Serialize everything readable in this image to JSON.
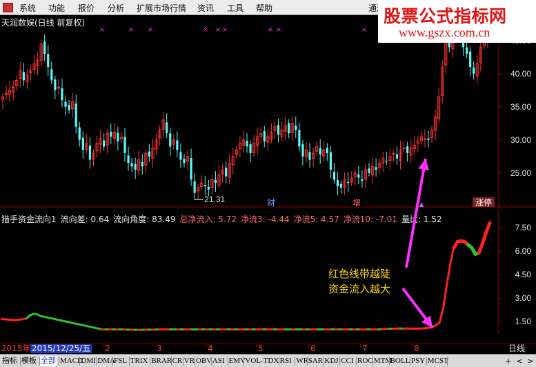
{
  "menu": {
    "items": [
      "系统",
      "功能",
      "报价",
      "分析",
      "扩展市场行情",
      "资讯",
      "工具",
      "帮助"
    ],
    "right_partial": "通达"
  },
  "watermark": {
    "title": "股票公式指标网",
    "url": "www.gszx.com.cn"
  },
  "stock_title": "天润数娱(日线 前复权)",
  "indicator_line": [
    {
      "text": "猎手资金流向1",
      "color": "white"
    },
    {
      "text": "流向差: 0.64",
      "color": "white"
    },
    {
      "text": "流向角度: 83.49",
      "color": "white"
    },
    {
      "text": "总净流入: 5.72",
      "color": "red"
    },
    {
      "text": "净流3: -4.44",
      "color": "red"
    },
    {
      "text": "净流5: 4.57",
      "color": "red"
    },
    {
      "text": "净流10: -7.01",
      "color": "red"
    },
    {
      "text": "量比: 1.52",
      "color": "white"
    }
  ],
  "annotation": {
    "line1": "红色线带越陡",
    "line2": "资金流入越大"
  },
  "event_labels": [
    "财",
    "增",
    "涨停"
  ],
  "chart_data": [
    {
      "type": "candlestick",
      "title": "天润数娱(日线 前复权)",
      "y_ticks": [
        25.0,
        30.0,
        35.0,
        40.0,
        45.0
      ],
      "ylim": [
        20.5,
        48
      ],
      "low_annotation": "21.31",
      "x_month_labels": [
        "2",
        "3",
        "4",
        "5",
        "6",
        "7",
        "8"
      ],
      "bullish_color": "#ff3030",
      "bearish_color": "#54fcfc",
      "close": [
        36.5,
        37.0,
        37.5,
        38.0,
        39.0,
        40.5,
        39.0,
        39.8,
        40.5,
        41.5,
        42.0,
        44.5,
        43.0,
        41.0,
        39.0,
        37.5,
        38.0,
        36.0,
        35.0,
        34.5,
        35.8,
        32.0,
        30.0,
        28.5,
        29.5,
        27.0,
        28.0,
        29.5,
        30.2,
        29.0,
        31.0,
        30.5,
        31.2,
        29.8,
        30.4,
        28.0,
        26.5,
        26.0,
        25.5,
        27.0,
        26.0,
        28.0,
        27.5,
        28.8,
        30.0,
        31.5,
        33.0,
        31.0,
        29.0,
        30.0,
        28.5,
        27.0,
        26.5,
        27.5,
        24.0,
        22.0,
        22.8,
        23.5,
        23.0,
        22.5,
        24.0,
        23.5,
        24.8,
        25.5,
        24.5,
        26.5,
        27.5,
        28.5,
        29.5,
        30.0,
        29.0,
        28.0,
        29.5,
        30.5,
        31.0,
        29.8,
        30.5,
        31.2,
        32.0,
        30.8,
        31.5,
        32.2,
        31.0,
        32.5,
        31.5,
        29.0,
        27.5,
        28.5,
        27.0,
        28.0,
        29.0,
        27.8,
        28.5,
        28.0,
        25.5,
        24.0,
        23.0,
        22.8,
        24.0,
        23.5,
        24.2,
        25.0,
        24.3,
        23.8,
        25.5,
        25.0,
        26.0,
        25.5,
        26.5,
        27.2,
        26.8,
        27.5,
        28.0,
        27.2,
        28.5,
        28.8,
        28.0,
        28.8,
        29.2,
        29.8,
        30.5,
        30.2,
        30.0,
        31.5,
        33.5,
        36.5,
        41.0,
        45.0,
        44.0,
        46.5,
        48.0,
        46.5,
        44.0,
        43.0,
        41.0,
        40.0,
        41.5,
        44.0,
        45.5,
        47.0,
        48.0
      ]
    },
    {
      "type": "line",
      "title": "猎手资金流向1",
      "y_ticks": [
        1.5,
        3.0,
        4.5,
        6.0,
        7.5
      ],
      "ylim": [
        0.8,
        8.2
      ],
      "colors": {
        "inflow": "#ff2020",
        "outflow": "#30c030"
      },
      "values": [
        1.65,
        1.65,
        1.62,
        1.6,
        1.6,
        1.62,
        1.65,
        1.7,
        1.9,
        2.0,
        1.95,
        1.85,
        1.8,
        1.75,
        1.7,
        1.65,
        1.6,
        1.55,
        1.5,
        1.45,
        1.4,
        1.35,
        1.3,
        1.25,
        1.2,
        1.15,
        1.1,
        1.05,
        1.0,
        1.0,
        1.0,
        1.0,
        1.0,
        1.0,
        1.0,
        0.98,
        0.98,
        0.97,
        0.97,
        0.97,
        0.98,
        0.98,
        0.98,
        0.99,
        1.0,
        1.0,
        1.0,
        1.0,
        1.0,
        1.0,
        1.0,
        1.0,
        1.0,
        1.0,
        1.0,
        1.0,
        1.0,
        1.0,
        1.0,
        1.0,
        1.0,
        1.0,
        1.0,
        1.0,
        1.0,
        1.0,
        1.0,
        1.0,
        1.0,
        1.0,
        1.0,
        1.0,
        1.0,
        1.0,
        1.0,
        1.0,
        1.0,
        1.0,
        1.0,
        1.0,
        1.0,
        1.0,
        1.0,
        1.0,
        1.0,
        1.0,
        1.0,
        1.0,
        1.0,
        1.0,
        1.0,
        1.0,
        1.0,
        1.0,
        1.0,
        1.0,
        1.0,
        1.0,
        1.0,
        1.0,
        1.0,
        1.0,
        1.0,
        1.0,
        1.0,
        1.0,
        1.02,
        1.03,
        1.04,
        1.05,
        1.05,
        1.06,
        1.05,
        1.06,
        1.05,
        1.05,
        1.05,
        1.06,
        1.07,
        1.1,
        1.15,
        1.25,
        1.45,
        2.3,
        3.8,
        5.2,
        6.2,
        6.6,
        6.65,
        6.6,
        6.4,
        6.2,
        5.8,
        5.9,
        6.5,
        7.2,
        7.8
      ],
      "direction": [
        "in",
        "in",
        "in",
        "in",
        "in",
        "in",
        "in",
        "in",
        "out",
        "out",
        "out",
        "out",
        "out",
        "out",
        "out",
        "out",
        "out",
        "out",
        "out",
        "out",
        "out",
        "out",
        "out",
        "out",
        "out",
        "out",
        "out",
        "out",
        "out",
        "in",
        "out",
        "in",
        "out",
        "in",
        "out",
        "in",
        "out",
        "in",
        "out",
        "in",
        "out",
        "in",
        "out",
        "in",
        "out",
        "in",
        "in",
        "in",
        "out",
        "out",
        "in",
        "out",
        "in",
        "in",
        "out",
        "out",
        "in",
        "out",
        "in",
        "out",
        "in",
        "out",
        "in",
        "in",
        "out",
        "in",
        "out",
        "in",
        "in",
        "out",
        "in",
        "out",
        "in",
        "in",
        "out",
        "in",
        "in",
        "out",
        "in",
        "in",
        "out",
        "out",
        "in",
        "out",
        "out",
        "in",
        "out",
        "in",
        "in",
        "out",
        "out",
        "in",
        "in",
        "out",
        "in",
        "out",
        "in",
        "in",
        "out",
        "in",
        "out",
        "in",
        "in",
        "out",
        "in",
        "in",
        "out",
        "in",
        "in",
        "out",
        "in",
        "in",
        "out",
        "in",
        "in",
        "in",
        "in",
        "in",
        "in",
        "in",
        "in",
        "in",
        "in",
        "in",
        "in",
        "in",
        "in",
        "in",
        "in",
        "in",
        "in",
        "out",
        "out",
        "out",
        "in",
        "in",
        "in",
        "in"
      ]
    }
  ],
  "date_row": {
    "year": "2015年",
    "selected_date": "2015/12/25/五",
    "period": "日线"
  },
  "tabs": [
    "指标",
    "模板",
    "全部",
    "MACD",
    "DMI",
    "DMA",
    "FSL",
    "TRIX",
    "BRAR",
    "CR",
    "VR",
    "OBV",
    "ASI",
    "EMV",
    "VOL-TDX",
    "RSI",
    "WR",
    "SAR",
    "KDJ",
    "CCI",
    "ROC",
    "MTM",
    "BOLL",
    "PSY",
    "MCST"
  ],
  "nav_buttons": [
    "+",
    "<",
    ">"
  ]
}
